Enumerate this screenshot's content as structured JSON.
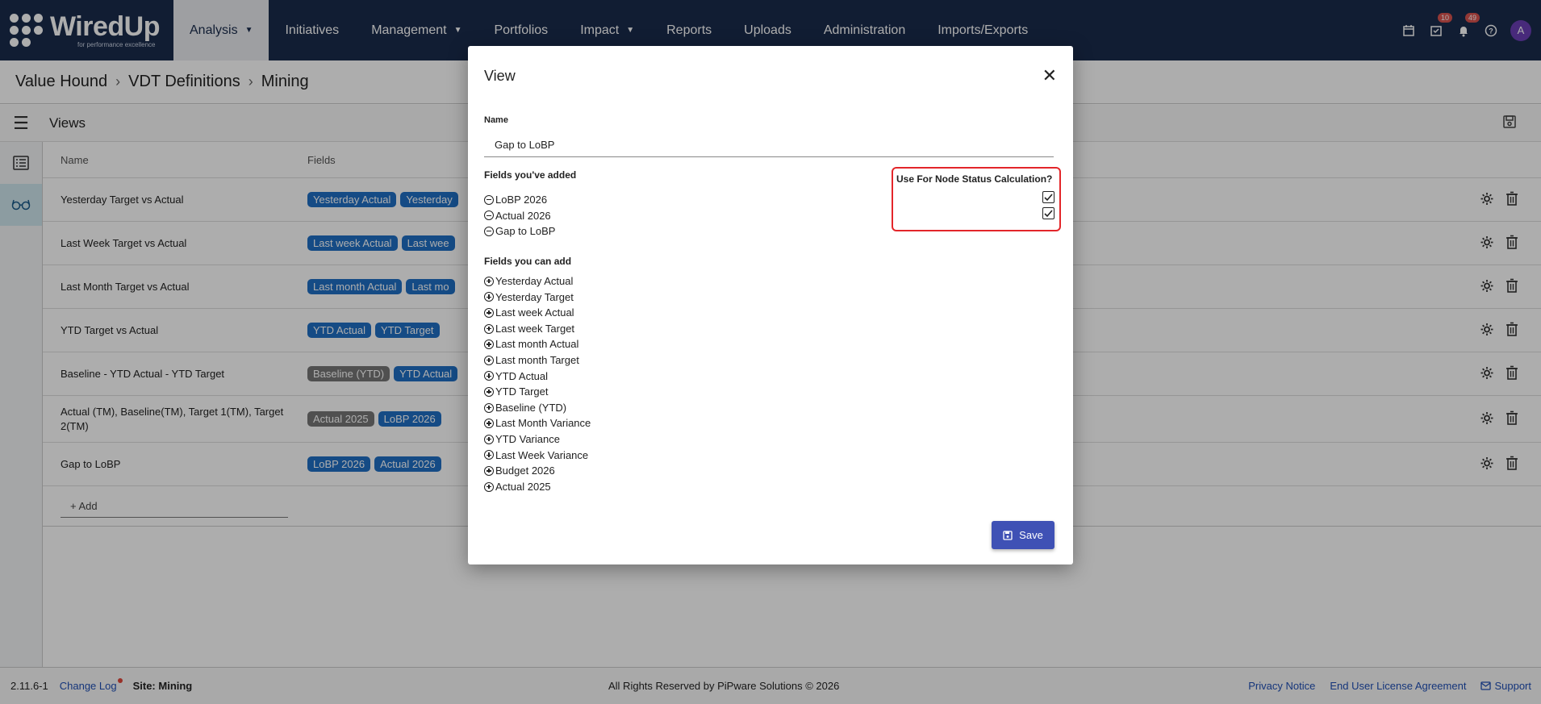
{
  "nav": {
    "logo_text": "WiredUp",
    "logo_tagline": "for performance excellence",
    "items": [
      {
        "label": "Analysis",
        "dropdown": true,
        "active": true
      },
      {
        "label": "Initiatives",
        "dropdown": false
      },
      {
        "label": "Management",
        "dropdown": true
      },
      {
        "label": "Portfolios",
        "dropdown": false
      },
      {
        "label": "Impact",
        "dropdown": true
      },
      {
        "label": "Reports",
        "dropdown": false
      },
      {
        "label": "Uploads",
        "dropdown": false
      },
      {
        "label": "Administration",
        "dropdown": false
      },
      {
        "label": "Imports/Exports",
        "dropdown": false
      }
    ],
    "tasks_badge": "10",
    "notifications_badge": "49",
    "avatar_initial": "A"
  },
  "breadcrumb": [
    "Value Hound",
    "VDT Definitions",
    "Mining"
  ],
  "views": {
    "title": "Views",
    "columns": {
      "name": "Name",
      "fields": "Fields"
    },
    "rows": [
      {
        "name": "Yesterday Target vs Actual",
        "tags": [
          {
            "text": "Yesterday Actual",
            "color": "#1f6fc5"
          },
          {
            "text": "Yesterday",
            "color": "#1f6fc5"
          }
        ]
      },
      {
        "name": "Last Week Target vs Actual",
        "tags": [
          {
            "text": "Last week Actual",
            "color": "#1f6fc5"
          },
          {
            "text": "Last wee",
            "color": "#1f6fc5"
          }
        ]
      },
      {
        "name": "Last Month Target vs Actual",
        "tags": [
          {
            "text": "Last month Actual",
            "color": "#1f6fc5"
          },
          {
            "text": "Last mo",
            "color": "#1f6fc5"
          }
        ]
      },
      {
        "name": "YTD Target vs Actual",
        "tags": [
          {
            "text": "YTD Actual",
            "color": "#1f6fc5"
          },
          {
            "text": "YTD Target",
            "color": "#1f6fc5"
          }
        ]
      },
      {
        "name": "Baseline - YTD Actual - YTD Target",
        "tags": [
          {
            "text": "Baseline (YTD)",
            "color": "#777777"
          },
          {
            "text": "YTD Actual",
            "color": "#1f6fc5"
          }
        ]
      },
      {
        "name": "Actual (TM), Baseline(TM), Target 1(TM), Target 2(TM)",
        "tags": [
          {
            "text": "Actual 2025",
            "color": "#777777"
          },
          {
            "text": "LoBP 2026",
            "color": "#1f6fc5"
          }
        ]
      },
      {
        "name": "Gap to LoBP",
        "tags": [
          {
            "text": "LoBP 2026",
            "color": "#1f6fc5"
          },
          {
            "text": "Actual 2026",
            "color": "#1f6fc5"
          }
        ]
      }
    ],
    "add_placeholder": "+ Add"
  },
  "footer": {
    "version": "2.11.6-1",
    "change_log": "Change Log",
    "site": "Site: Mining",
    "copyright": "All Rights Reserved by PiPware Solutions © 2026",
    "privacy": "Privacy Notice",
    "eula": "End User License Agreement",
    "support": "Support"
  },
  "modal": {
    "title": "View",
    "name_label": "Name",
    "name_value": "Gap to LoBP",
    "added_title": "Fields you've added",
    "added_fields": [
      "LoBP 2026",
      "Actual 2026",
      "Gap to LoBP"
    ],
    "node_status_title": "Use For Node Status Calculation?",
    "node_status_checked": [
      true,
      true
    ],
    "available_title": "Fields you can add",
    "available_fields": [
      "Yesterday Actual",
      "Yesterday Target",
      "Last week Actual",
      "Last week Target",
      "Last month Actual",
      "Last month Target",
      "YTD Actual",
      "YTD Target",
      "Baseline (YTD)",
      "Last Month Variance",
      "YTD Variance",
      "Last Week Variance",
      "Budget 2026",
      "Actual 2025"
    ],
    "save_label": "Save"
  },
  "colors": {
    "nav_bg": "#1a2b4c",
    "tag_blue": "#1f6fc5",
    "tag_grey": "#777777",
    "save_button": "#3f51b5",
    "highlight_border": "#e3262a",
    "link": "#1f4fb5"
  }
}
